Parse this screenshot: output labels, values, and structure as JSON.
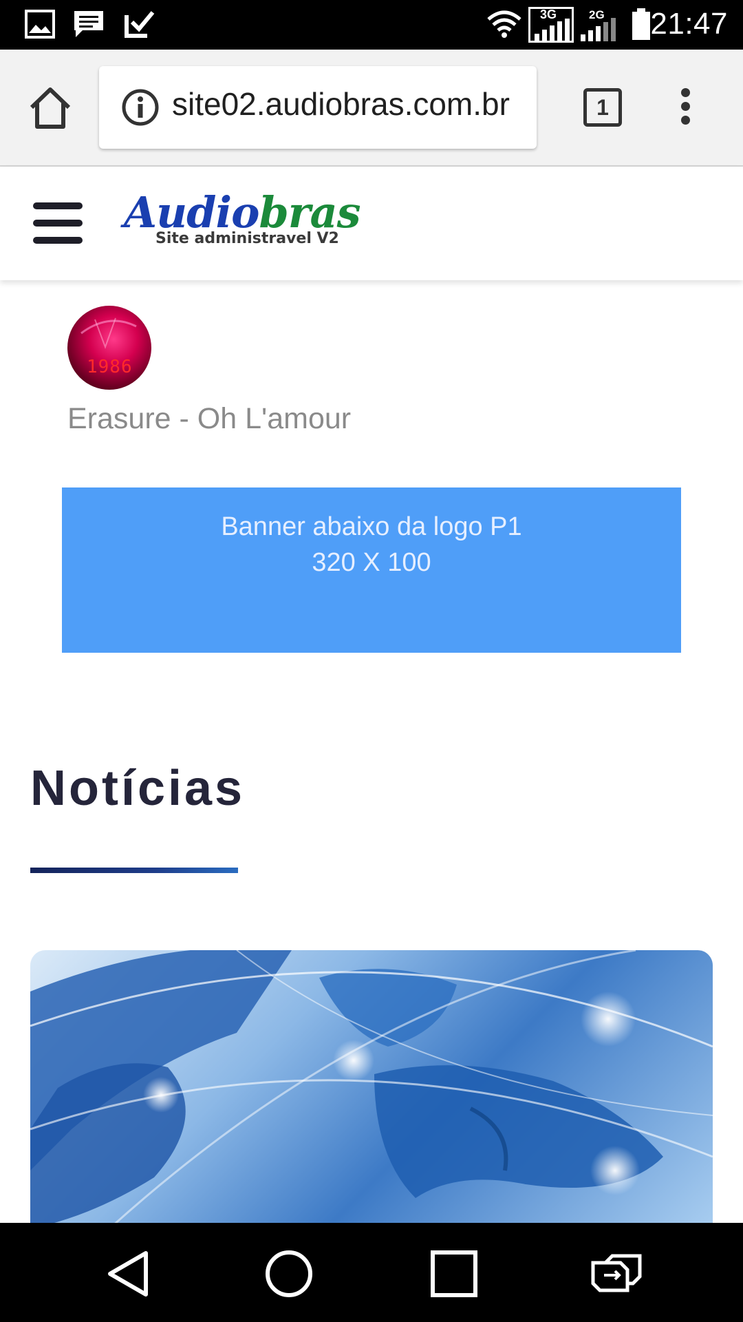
{
  "status_bar": {
    "time": "21:47",
    "network_1": "3G",
    "network_2": "2G",
    "icons": [
      "gallery-icon",
      "message-icon",
      "task-check-icon",
      "wifi-icon",
      "signal-3g-icon",
      "signal-2g-icon",
      "battery-icon"
    ]
  },
  "browser": {
    "url": "site02.audiobras.com.br",
    "tab_count": "1",
    "icons": [
      "home-icon",
      "info-icon",
      "tabs-icon",
      "overflow-menu-icon"
    ]
  },
  "site_header": {
    "logo_part1": "Audio",
    "logo_part2": "bras",
    "logo_subtitle": "Site administravel V2",
    "icons": [
      "hamburger-menu-icon"
    ],
    "colors": {
      "logo_blue": "#1a3fb0",
      "logo_green": "#1b8a3a"
    }
  },
  "now_playing": {
    "cover_text": "1986",
    "track_title": "Erasure - Oh L'amour"
  },
  "banner": {
    "line1": "Banner abaixo da logo P1",
    "line2": "320 X 100",
    "color": "#4f9ef8"
  },
  "news": {
    "heading": "Notícias",
    "underline_color": "#1e3d8a"
  },
  "nav_bar": {
    "icons": [
      "back-icon",
      "home-circle-icon",
      "recents-icon",
      "switch-app-icon"
    ]
  }
}
